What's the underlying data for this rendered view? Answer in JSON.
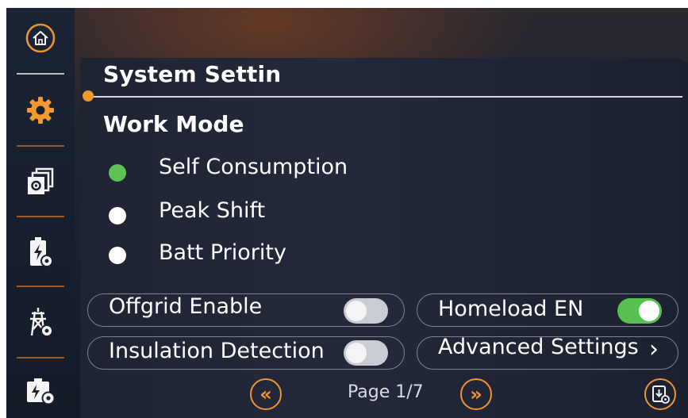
{
  "page": {
    "title": "System Settin",
    "section_title": "Work  Mode",
    "work_modes": [
      {
        "label": "Self Consumption",
        "selected": true
      },
      {
        "label": "Peak Shift",
        "selected": false
      },
      {
        "label": "Batt Priority",
        "selected": false
      }
    ],
    "options": {
      "offgrid_enable": {
        "label": "Offgrid Enable",
        "state": "off"
      },
      "homeload_en": {
        "label": "Homeload EN",
        "state": "on"
      },
      "insulation_detection": {
        "label": "Insulation Detection",
        "state": "off"
      },
      "advanced_settings": {
        "label": "Advanced Settings",
        "chevron": "›"
      }
    },
    "pagination": {
      "label": "Page 1/7",
      "prev_glyph": "«",
      "next_glyph": "»"
    }
  },
  "sidebar": {
    "items": [
      {
        "name": "home",
        "icon": "home-icon"
      },
      {
        "name": "system-settings",
        "icon": "gear-icon",
        "active": true
      },
      {
        "name": "device-settings",
        "icon": "stacked-settings-icon"
      },
      {
        "name": "battery-settings",
        "icon": "battery-gear-icon"
      },
      {
        "name": "grid-settings",
        "icon": "tower-gear-icon"
      },
      {
        "name": "inverter-settings",
        "icon": "inverter-gear-icon"
      }
    ]
  },
  "colors": {
    "accent": "#f09432",
    "active_green": "#5fc254",
    "divider": "#b5662c"
  }
}
